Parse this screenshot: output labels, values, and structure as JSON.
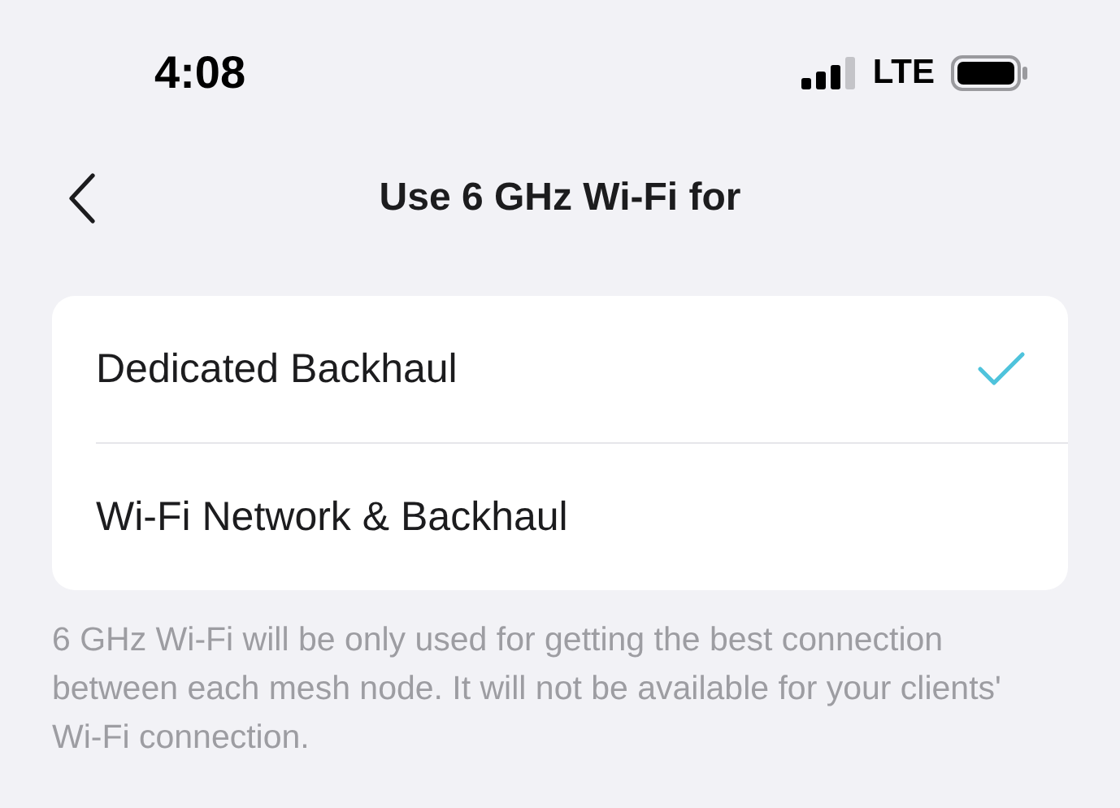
{
  "status_bar": {
    "time": "4:08",
    "network": "LTE"
  },
  "nav": {
    "title": "Use 6 GHz Wi-Fi for"
  },
  "options": [
    {
      "label": "Dedicated Backhaul",
      "selected": true
    },
    {
      "label": "Wi-Fi Network & Backhaul",
      "selected": false
    }
  ],
  "footnote": "6 GHz Wi-Fi will be only used for getting the best connection between each mesh node. It will not be available for your clients' Wi-Fi connection."
}
